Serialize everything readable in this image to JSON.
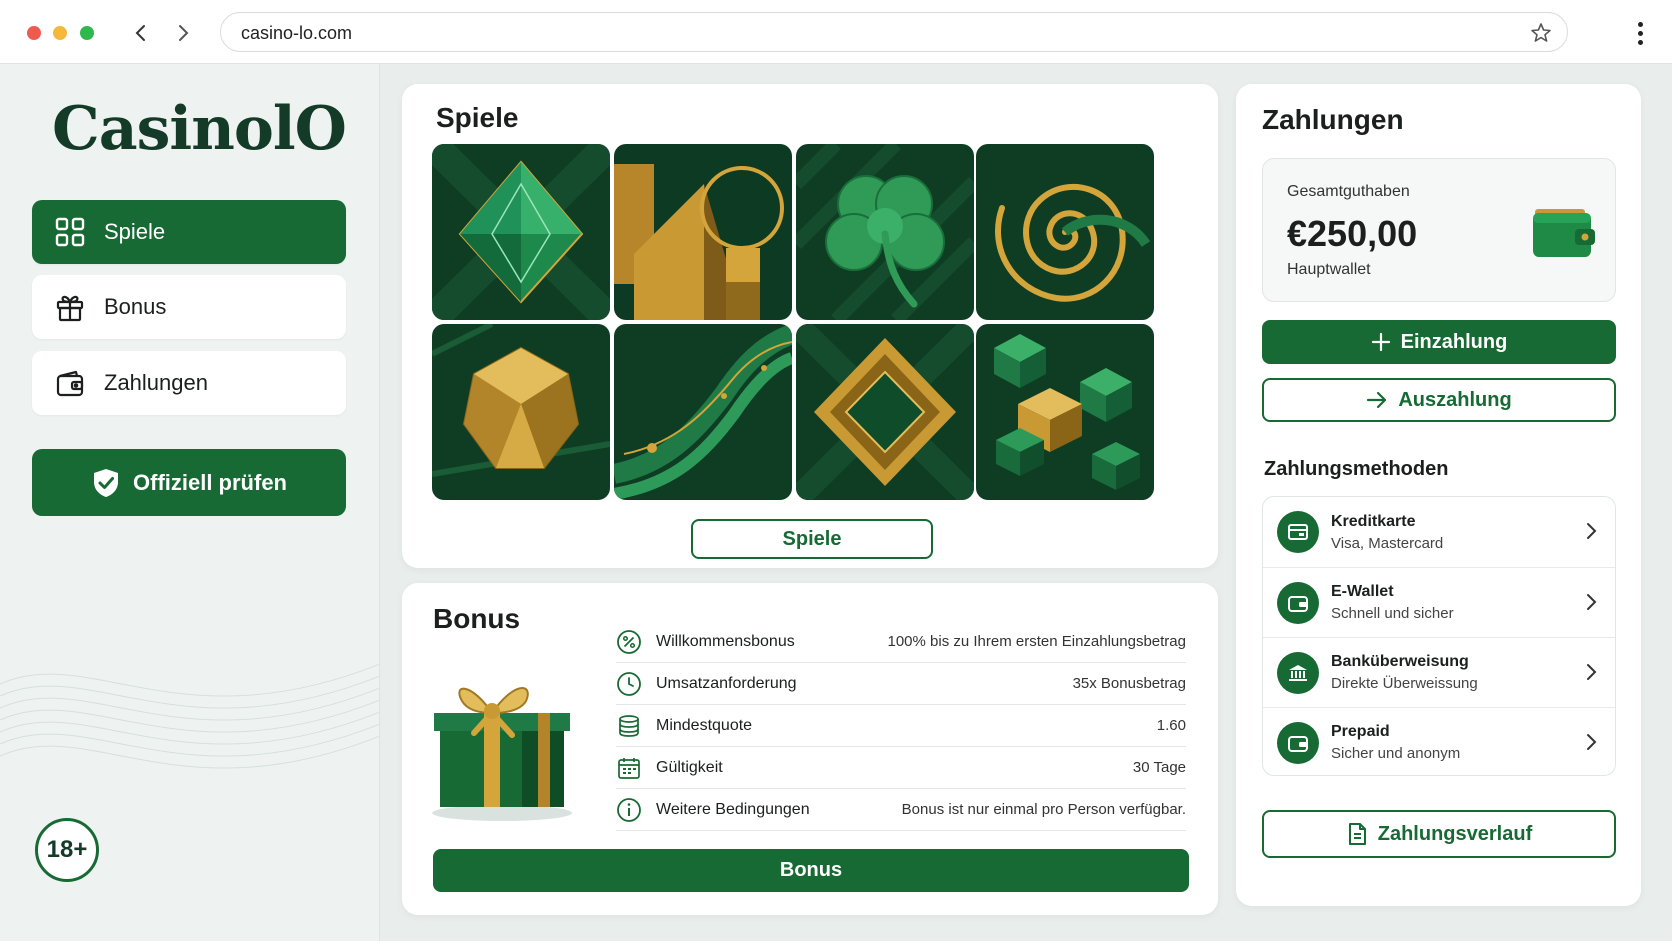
{
  "browser": {
    "url": "casino-lo.com"
  },
  "sidebar": {
    "logo": "CasinolO",
    "items": [
      {
        "label": "Spiele",
        "icon": "grid-icon",
        "active": true
      },
      {
        "label": "Bonus",
        "icon": "gift-icon",
        "active": false
      },
      {
        "label": "Zahlungen",
        "icon": "wallet-icon",
        "active": false
      }
    ],
    "verify_label": "Offiziell prüfen",
    "age_badge": "18+"
  },
  "games": {
    "title": "Spiele",
    "tiles": [
      {
        "icon": "emerald-gem-icon"
      },
      {
        "icon": "gold-geometry-icon"
      },
      {
        "icon": "clover-icon"
      },
      {
        "icon": "gold-spiral-icon"
      },
      {
        "icon": "gold-polyhedron-icon"
      },
      {
        "icon": "green-waves-icon"
      },
      {
        "icon": "gold-diamond-icon"
      },
      {
        "icon": "cubes-icon"
      }
    ],
    "button_label": "Spiele"
  },
  "bonus": {
    "title": "Bonus",
    "rows": [
      {
        "icon": "percent-icon",
        "label": "Willkommensbonus",
        "value": "100% bis zu Ihrem ersten Einzahlungsbetrag"
      },
      {
        "icon": "clock-icon",
        "label": "Umsatzanforderung",
        "value": "35x Bonusbetrag"
      },
      {
        "icon": "coins-icon",
        "label": "Mindestquote",
        "value": "1.60"
      },
      {
        "icon": "calendar-icon",
        "label": "Gültigkeit",
        "value": "30 Tage"
      },
      {
        "icon": "info-icon",
        "label": "Weitere Bedingungen",
        "value": "Bonus ist nur einmal pro Person verfügbar."
      }
    ],
    "button_label": "Bonus"
  },
  "payments": {
    "title": "Zahlungen",
    "balance_label": "Gesamtguthaben",
    "balance_amount": "€250,00",
    "wallet_name": "Hauptwallet",
    "deposit_label": "Einzahlung",
    "withdraw_label": "Auszahlung",
    "methods_title": "Zahlungsmethoden",
    "methods": [
      {
        "icon": "card-icon",
        "name": "Kreditkarte",
        "desc": "Visa, Mastercard"
      },
      {
        "icon": "wallet-icon",
        "name": "E-Wallet",
        "desc": "Schnell und sicher"
      },
      {
        "icon": "bank-icon",
        "name": "Banküberweisung",
        "desc": "Direkte Überweissung"
      },
      {
        "icon": "prepaid-icon",
        "name": "Prepaid",
        "desc": "Sicher und anonym"
      }
    ],
    "history_label": "Zahlungsverlauf"
  },
  "colors": {
    "brand_green": "#176a33",
    "dark_green": "#133b27",
    "gold": "#d4a53a"
  }
}
